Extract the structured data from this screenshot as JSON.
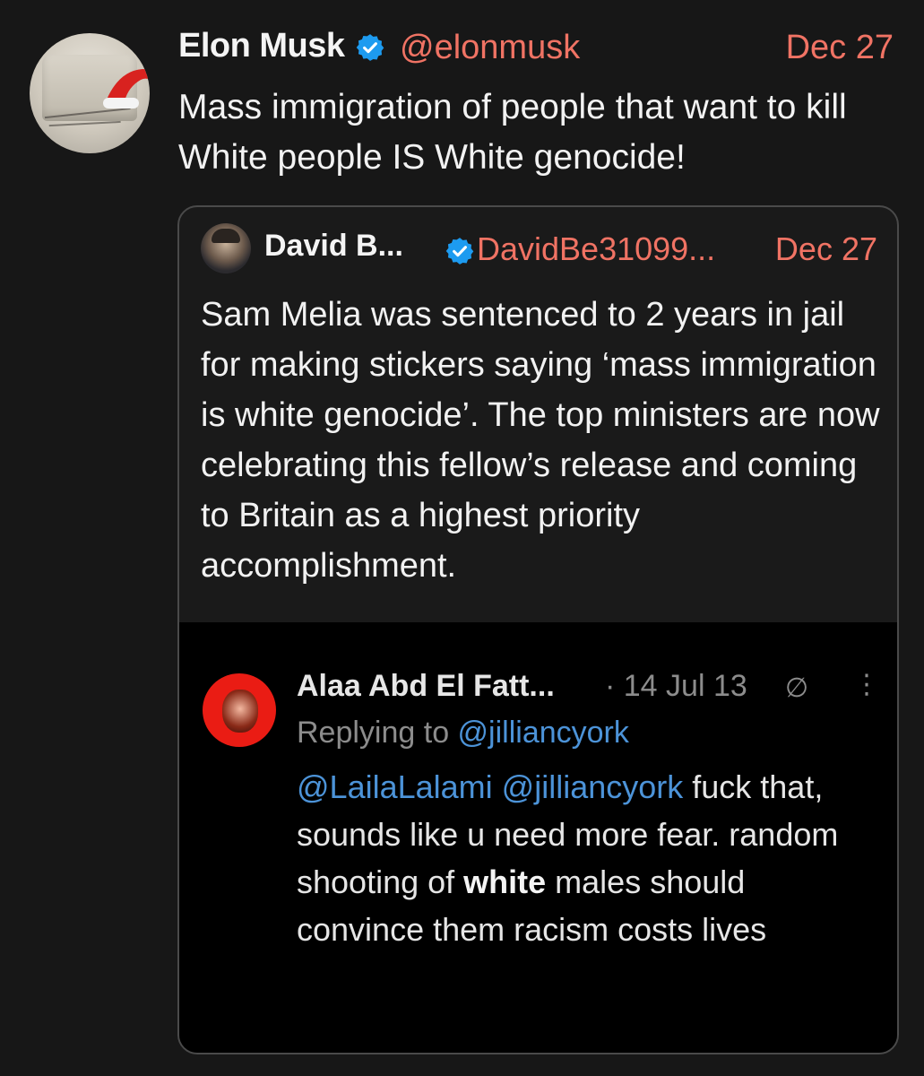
{
  "tweet": {
    "name": "Elon Musk",
    "handle": "@elonmusk",
    "date": "Dec 27",
    "text": "Mass immigration of people that want to kill White people IS White genocide!",
    "avatar_icon": "santa-hat-icon",
    "verified_icon": "verified-badge-icon"
  },
  "quoted": {
    "name": "David B...",
    "handle": "DavidBe31099...",
    "date": "Dec 27",
    "text": "Sam Melia was sentenced to 2 years in jail for making stickers saying ‘mass immigration is white genocide’. The top ministers are now celebrating this fellow’s release and coming to Britain as a highest priority accomplishment."
  },
  "embedded": {
    "name": "Alaa Abd El Fatt...",
    "meta": "· 14 Jul 13",
    "reply_prefix": "Replying to ",
    "reply_to": "@jilliancyork",
    "mentions": "@LailaLalami @jilliancyork",
    "text_a": " fuck that, sounds like u need more fear. random shooting of ",
    "text_bold": "white",
    "text_b": " males should convince them racism costs lives",
    "protected_icon": "∅",
    "more_icon": "⋮"
  },
  "colors": {
    "background": "#171717",
    "accent": "#f07364",
    "verified": "#1d9bf0",
    "link": "#4c93d8"
  }
}
